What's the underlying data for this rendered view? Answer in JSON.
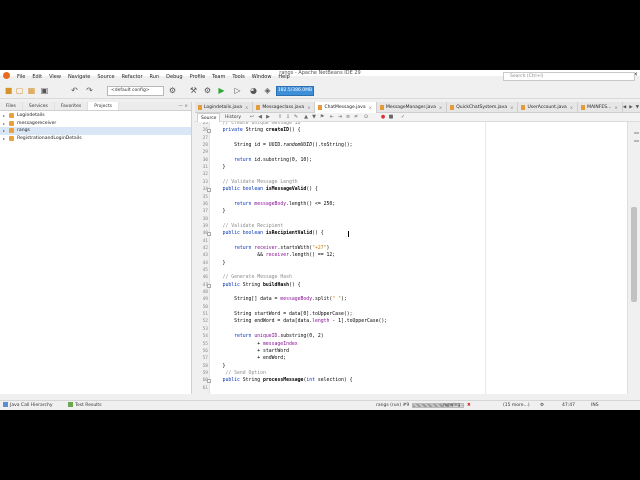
{
  "window": {
    "title": "rangs - Apache NetBeans IDE 29"
  },
  "menubar": {
    "items": [
      "File",
      "Edit",
      "View",
      "Navigate",
      "Source",
      "Refactor",
      "Run",
      "Debug",
      "Profile",
      "Team",
      "Tools",
      "Window",
      "Help"
    ],
    "search_placeholder": "Search (Ctrl+I)"
  },
  "toolbar": {
    "config_select": "<default config>",
    "memory_label": "182.5/386.0MB"
  },
  "left_panel": {
    "tabs": [
      "Files",
      "Services",
      "Favorites",
      "Projects"
    ],
    "active_tab": "Projects",
    "projects": [
      {
        "name": "Logindetails",
        "selected": false
      },
      {
        "name": "messagereceiver",
        "selected": false
      },
      {
        "name": "rangs",
        "selected": true
      },
      {
        "name": "RegistrationandLoginDetails",
        "selected": false
      }
    ]
  },
  "editor_tabs": [
    {
      "label": "Logindetails.java",
      "active": false
    },
    {
      "label": "Messageclass.java",
      "active": false
    },
    {
      "label": "ChatMessage.java",
      "active": true
    },
    {
      "label": "MessageManager.java",
      "active": false
    },
    {
      "label": "QuickChatSystem.java",
      "active": false
    },
    {
      "label": "UserAccount.java",
      "active": false
    },
    {
      "label": "MAINFES...",
      "active": false
    }
  ],
  "editor_toolbar": {
    "source_label": "Source",
    "history_label": "History"
  },
  "code_lines": [
    {
      "n": "25",
      "html": "    <span class='cm'>// Create unique message ID</span>"
    },
    {
      "n": "26",
      "html": "    <span class='kw'>private</span> String <span class='bold'>createID</span>() {",
      "fold": true
    },
    {
      "n": "27",
      "html": ""
    },
    {
      "n": "28",
      "html": "        String id = UUID.<i>randomUUID</i>().toString();"
    },
    {
      "n": "29",
      "html": ""
    },
    {
      "n": "30",
      "html": "        <span class='kw'>return</span> id.substring(0, 10);"
    },
    {
      "n": "31",
      "html": "    }"
    },
    {
      "n": "32",
      "html": ""
    },
    {
      "n": "33",
      "html": "    <span class='cm'>// Validate Message Length</span>"
    },
    {
      "n": "34",
      "html": "    <span class='kw'>public boolean</span> <span class='bold'>isMessageValid</span>() {",
      "fold": true
    },
    {
      "n": "35",
      "html": ""
    },
    {
      "n": "36",
      "html": "        <span class='kw'>return</span> <span class='fld'>messageBody</span>.length() &lt;= 250;"
    },
    {
      "n": "37",
      "html": "    }"
    },
    {
      "n": "38",
      "html": ""
    },
    {
      "n": "39",
      "html": "    <span class='cm'>// Validate Recipient</span>"
    },
    {
      "n": "40",
      "html": "    <span class='kw'>public boolean</span> <span class='bold'>isRecipientValid</span>() {",
      "fold": true
    },
    {
      "n": "41",
      "html": ""
    },
    {
      "n": "42",
      "html": "        <span class='kw'>return</span> <span class='fld'>receiver</span>.startsWith(<span class='str'>\"+27\"</span>)"
    },
    {
      "n": "43",
      "html": "                &amp;&amp; <span class='fld'>receiver</span>.length() == 12;"
    },
    {
      "n": "44",
      "html": "    }"
    },
    {
      "n": "45",
      "html": ""
    },
    {
      "n": "46",
      "html": "    <span class='cm'>// Generate Message Hash</span>"
    },
    {
      "n": "47",
      "html": "    <span class='kw'>public</span> String <span class='bold'>buildHash</span>() {",
      "fold": true
    },
    {
      "n": "48",
      "html": ""
    },
    {
      "n": "49",
      "html": "        String[] data = <span class='fld'>messageBody</span>.split(<span class='str'>\" \"</span>);"
    },
    {
      "n": "50",
      "html": ""
    },
    {
      "n": "51",
      "html": "        String startWord = data[0].toUpperCase();"
    },
    {
      "n": "52",
      "html": "        String endWord = data[data.<span class='fld'>length</span> - 1].toUpperCase();"
    },
    {
      "n": "53",
      "html": ""
    },
    {
      "n": "54",
      "html": "        <span class='kw'>return</span> <span class='fld'>uniqueID</span>.substring(0, 2)"
    },
    {
      "n": "55",
      "html": "                + <span class='fld'>messageIndex</span>"
    },
    {
      "n": "56",
      "html": "                + startWord"
    },
    {
      "n": "57",
      "html": "                + endWord;"
    },
    {
      "n": "58",
      "html": "    }"
    },
    {
      "n": "59",
      "html": "     <span class='cm'>// Send Option</span>"
    },
    {
      "n": "60",
      "html": "    <span class='kw'>public</span> String <span class='bold'>processMessage</span>(<span class='kw'>int</span> selection) {",
      "fold": true
    },
    {
      "n": "61",
      "html": ""
    }
  ],
  "statusbar": {
    "call_hierarchy": "Java Call Hierarchy",
    "test_results": "Test Results",
    "run_label": "rangs (run) #9",
    "running_label": "running...",
    "progress_fraction": 0.8,
    "more_label": "(15 more...)",
    "position": "47:47",
    "mode": "INS"
  }
}
